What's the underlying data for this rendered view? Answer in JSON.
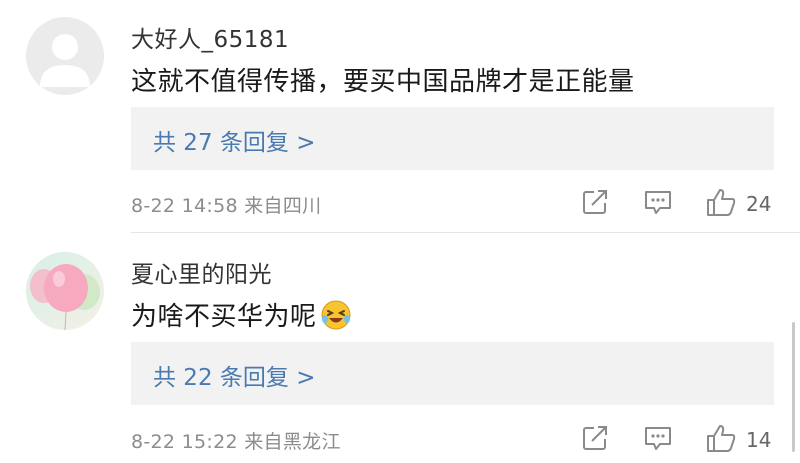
{
  "comments": [
    {
      "username": "大好人_65181",
      "text": "这就不值得传播，要买中国品牌才是正能量",
      "replies_label": "共 27 条回复 >",
      "meta": "8-22 14:58 来自四川",
      "likes": "24",
      "avatar_icon": "default-user-avatar",
      "share_icon": "share-icon",
      "comment_icon": "comment-icon",
      "like_icon": "thumbs-up-icon"
    },
    {
      "username": "夏心里的阳光",
      "text": "为啥不买华为呢",
      "emoji_icon": "laughing-crying-emoji",
      "replies_label": "共 22 条回复 >",
      "meta": "8-22 15:22 来自黑龙江",
      "likes": "14",
      "avatar_icon": "pink-balloon-avatar",
      "share_icon": "share-icon",
      "comment_icon": "comment-icon",
      "like_icon": "thumbs-up-icon"
    }
  ],
  "colors": {
    "link": "#4a7ab0",
    "reply_box_bg": "#f2f2f2",
    "meta_text": "#8c8c8c"
  }
}
